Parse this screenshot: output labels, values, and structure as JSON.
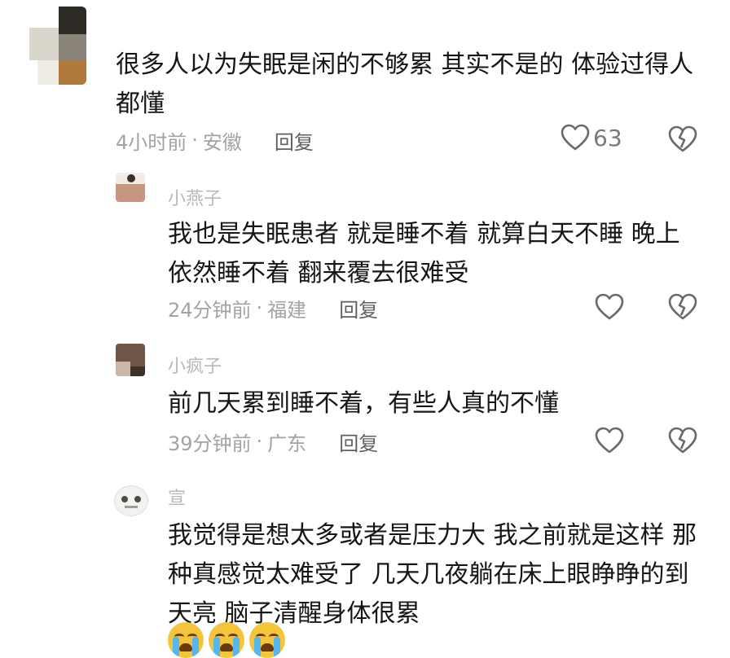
{
  "comments": [
    {
      "username": "",
      "text": "很多人以为失眠是闲的不够累   其实不是的   体验过得人都懂",
      "time": "4小时前",
      "location": "安徽",
      "reply_label": "回复",
      "like_count": "63"
    },
    {
      "username": "小燕子",
      "text": "我也是失眠患者  就是睡不着  就算白天不睡  晚上依然睡不着  翻来覆去很难受",
      "time": "24分钟前",
      "location": "福建",
      "reply_label": "回复",
      "like_count": ""
    },
    {
      "username": "小疯子",
      "text": "前几天累到睡不着，有些人真的不懂",
      "time": "39分钟前",
      "location": "广东",
      "reply_label": "回复",
      "like_count": ""
    },
    {
      "username": "宣",
      "text": "我觉得是想太多或者是压力大  我之前就是这样  那种真感觉太难受了  几天几夜躺在床上眼睁睁的到天亮  脑子清醒身体很累",
      "time": "",
      "location": "",
      "reply_label": "",
      "like_count": ""
    }
  ],
  "meta_separator": "·",
  "icons": {
    "like": "heart-outline-icon",
    "dislike": "broken-heart-outline-icon",
    "emoji": "loudly-crying-face-emoji"
  },
  "emoji_count": 3,
  "colors": {
    "text": "#161616",
    "meta": "#a3a3a3",
    "reply": "#5f5f5f",
    "icon": "#6a6a6a"
  }
}
